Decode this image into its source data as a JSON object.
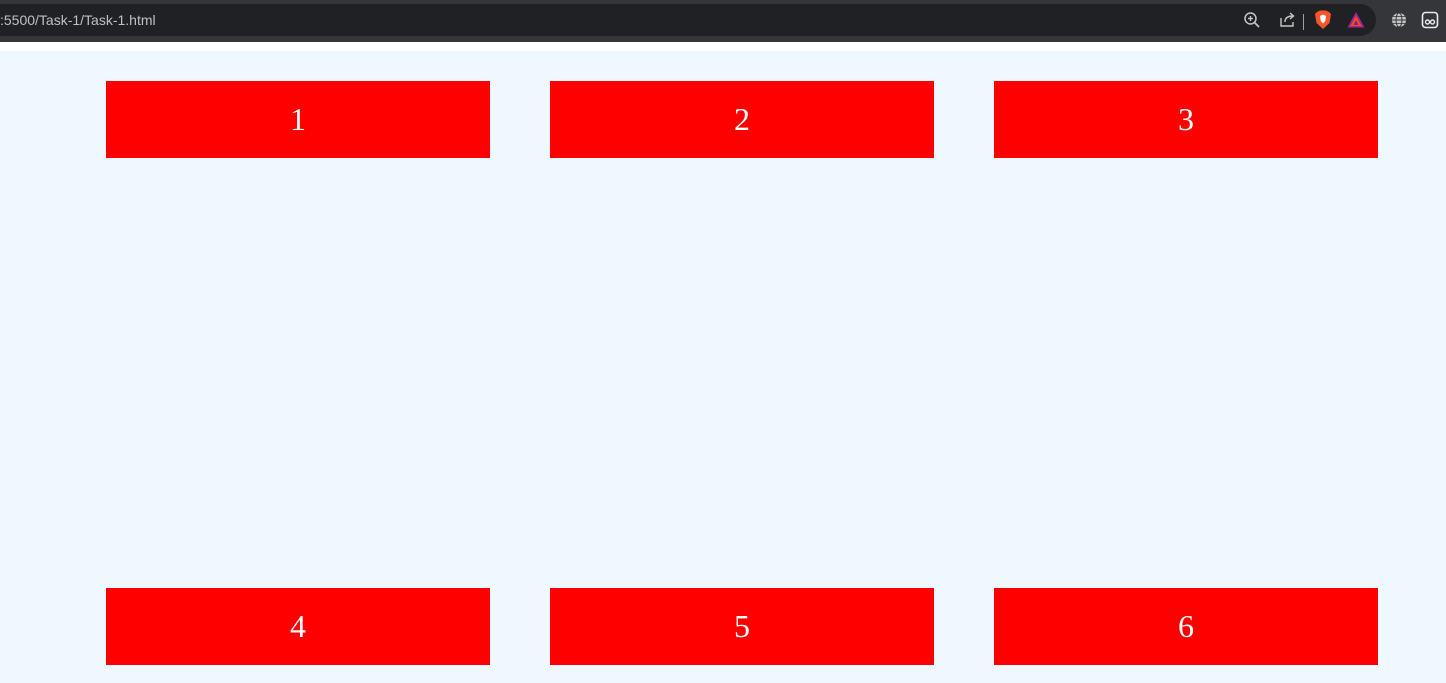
{
  "browser": {
    "url": ":5500/Task-1/Task-1.html",
    "icons": [
      "zoom-icon",
      "share-icon",
      "brave-shield-icon",
      "brave-rewards-icon",
      "translate-globe-icon",
      "extension-icon"
    ]
  },
  "colors": {
    "toolbar": "#35363a",
    "omnibox": "#202124",
    "page_background": "#eef8fe",
    "box_background": "#ff0000",
    "box_text": "#ffffff"
  },
  "boxes": [
    {
      "label": "1"
    },
    {
      "label": "2"
    },
    {
      "label": "3"
    },
    {
      "label": "4"
    },
    {
      "label": "5"
    },
    {
      "label": "6"
    }
  ]
}
